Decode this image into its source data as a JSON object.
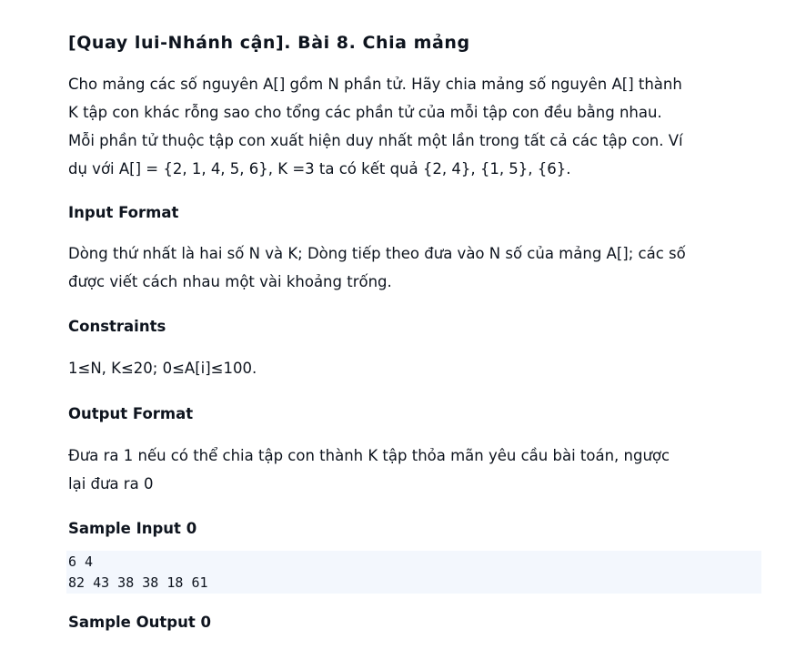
{
  "problem": {
    "title": "[Quay lui-Nhánh cận]. Bài 8. Chia mảng",
    "description_lines": [
      "Cho mảng các số nguyên A[] gồm N phần tử. Hãy chia mảng số nguyên A[] thành",
      "K tập con khác rỗng sao cho tổng các phần tử của mỗi tập con đều bằng nhau.",
      "Mỗi phần tử thuộc tập con xuất hiện duy nhất một lần trong tất cả các tập con. Ví",
      "dụ với A[] = {2, 1, 4, 5, 6}, K =3 ta có kết quả {2, 4}, {1, 5}, {6}."
    ]
  },
  "input_format": {
    "heading": "Input Format",
    "lines": [
      "Dòng thứ nhất là hai số N và K; Dòng tiếp theo đưa vào N số của mảng A[]; các số",
      "được viết cách nhau một vài khoảng trống."
    ]
  },
  "constraints": {
    "heading": "Constraints",
    "lines": [
      "1≤N, K≤20; 0≤A[i]≤100."
    ]
  },
  "output_format": {
    "heading": "Output Format",
    "lines": [
      "Đưa ra 1 nếu có thể chia tập con thành K tập thỏa mãn yêu cầu bài toán, ngược",
      "lại đưa ra 0"
    ]
  },
  "sample_input": {
    "heading": "Sample Input 0",
    "lines": [
      "6 4",
      "82 43 38 38 18 61"
    ]
  },
  "sample_output": {
    "heading": "Sample Output 0"
  }
}
